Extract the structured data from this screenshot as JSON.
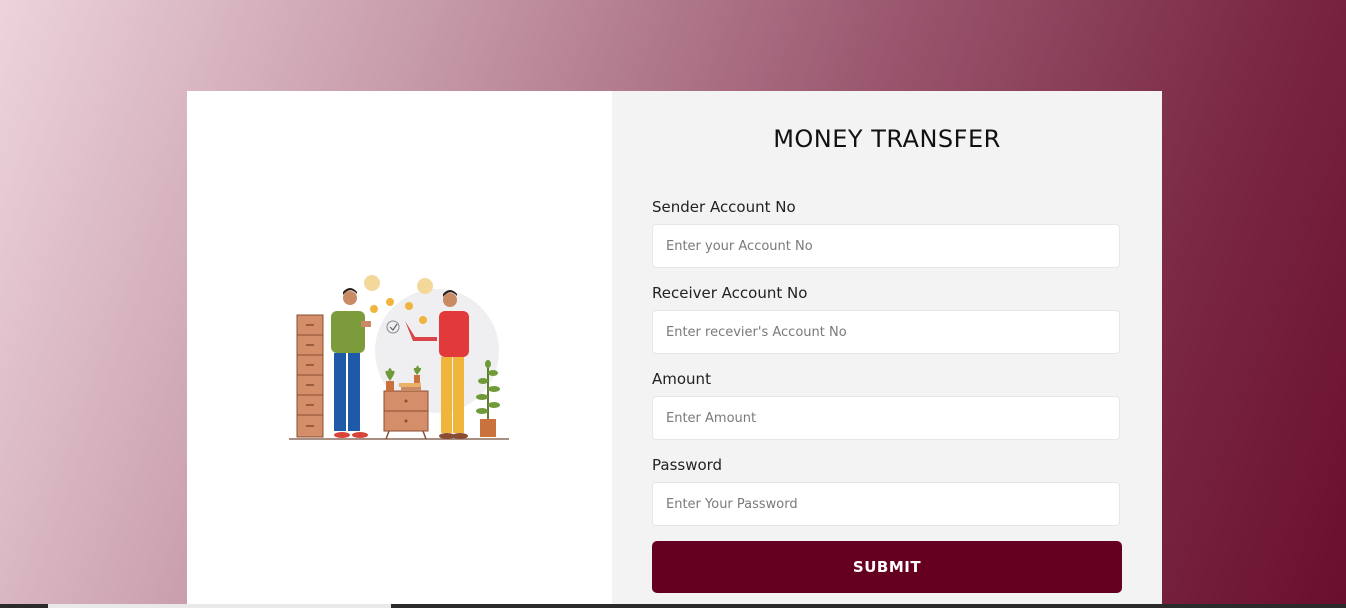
{
  "form": {
    "title": "MONEY TRANSFER",
    "fields": [
      {
        "label": "Sender Account No",
        "placeholder": "Enter your Account No",
        "value": ""
      },
      {
        "label": "Receiver Account No",
        "placeholder": "Enter recevier's Account No",
        "value": ""
      },
      {
        "label": "Amount",
        "placeholder": "Enter Amount",
        "value": ""
      },
      {
        "label": "Password",
        "placeholder": "Enter Your Password",
        "value": ""
      }
    ],
    "submit_label": "SUBMIT"
  },
  "illustration": {
    "name": "two-people-money-transfer-illustration"
  },
  "colors": {
    "accent": "#650021",
    "panel": "#f3f3f3",
    "background_start": "#ecd3dc",
    "background_end": "#6a0f2e"
  }
}
